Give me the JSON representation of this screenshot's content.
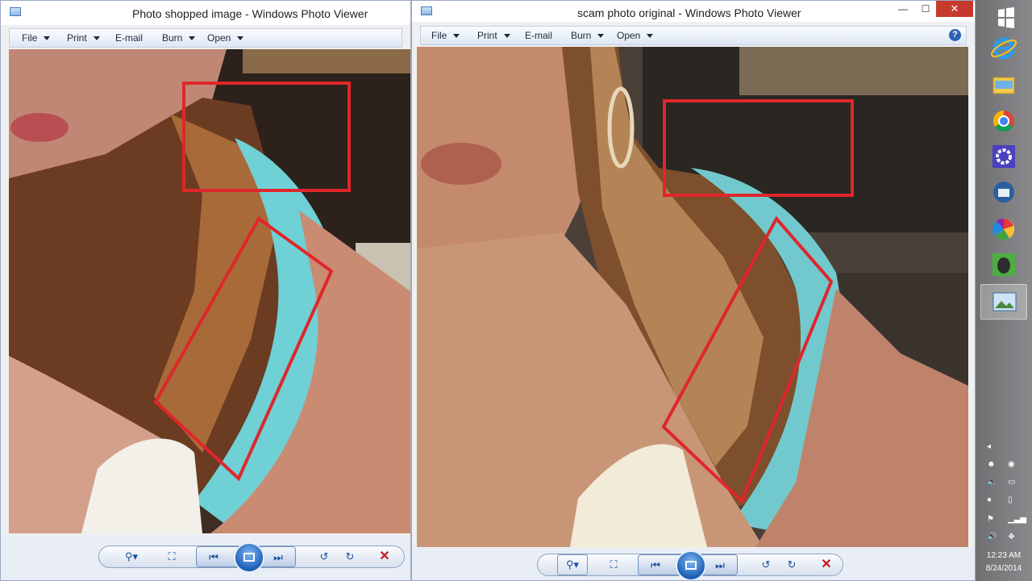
{
  "left_window": {
    "title": "Photo shopped image - Windows Photo Viewer",
    "menu": [
      {
        "label": "File",
        "dropdown": true
      },
      {
        "label": "Print",
        "dropdown": true
      },
      {
        "label": "E-mail",
        "dropdown": false
      },
      {
        "label": "Burn",
        "dropdown": true
      },
      {
        "label": "Open",
        "dropdown": true
      }
    ]
  },
  "right_window": {
    "title": "scam photo original - Windows Photo Viewer",
    "menu": [
      {
        "label": "File",
        "dropdown": true
      },
      {
        "label": "Print",
        "dropdown": true
      },
      {
        "label": "E-mail",
        "dropdown": false
      },
      {
        "label": "Burn",
        "dropdown": true
      },
      {
        "label": "Open",
        "dropdown": true
      }
    ],
    "help_glyph": "?",
    "controls": {
      "minimize": "—",
      "maximize": "☐",
      "close": "✕"
    }
  },
  "toolbar": {
    "zoom_icon": "zoom-icon",
    "actual_size_icon": "fit-window-icon",
    "previous_icon": "previous-icon",
    "slideshow_icon": "slideshow-icon",
    "next_icon": "next-icon",
    "rotate_ccw_icon": "rotate-counterclockwise-icon",
    "rotate_cw_icon": "rotate-clockwise-icon",
    "delete_icon": "delete-icon"
  },
  "colors": {
    "annotation_red": "#e0262b",
    "skin": "#c98f78",
    "hair": "#6a3a22",
    "turquoise": "#6fd0d6",
    "taskbar": "#7a7a7e"
  },
  "taskbar": {
    "apps": [
      {
        "name": "windows-start-icon"
      },
      {
        "name": "internet-explorer-icon"
      },
      {
        "name": "file-explorer-icon"
      },
      {
        "name": "chrome-icon"
      },
      {
        "name": "settings-icon"
      },
      {
        "name": "thunderbird-icon"
      },
      {
        "name": "picasa-icon"
      },
      {
        "name": "evernote-icon"
      },
      {
        "name": "photo-viewer-icon"
      }
    ],
    "time": "12:23 AM",
    "date": "8/24/2014"
  }
}
